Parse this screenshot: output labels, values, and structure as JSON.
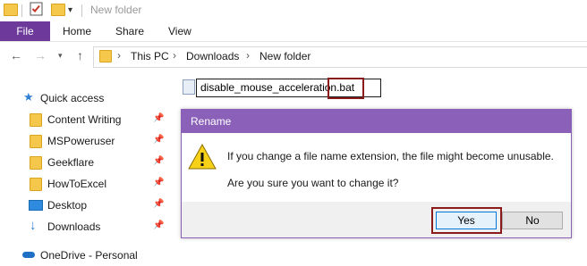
{
  "window": {
    "title": "New folder"
  },
  "ribbon": {
    "tabs": [
      "File",
      "Home",
      "Share",
      "View"
    ]
  },
  "address": {
    "crumbs": [
      "This PC",
      "Downloads",
      "New folder"
    ]
  },
  "sidebar": {
    "items": [
      {
        "label": "Quick access",
        "icon": "star-icon",
        "pinned": false
      },
      {
        "label": "Content Writing",
        "icon": "folder-icon",
        "pinned": true
      },
      {
        "label": "MSPoweruser",
        "icon": "folder-icon",
        "pinned": true
      },
      {
        "label": "Geekflare",
        "icon": "folder-icon",
        "pinned": true
      },
      {
        "label": "HowToExcel",
        "icon": "folder-icon",
        "pinned": true
      },
      {
        "label": "Desktop",
        "icon": "desktop-icon",
        "pinned": true
      },
      {
        "label": "Downloads",
        "icon": "download-icon",
        "pinned": true
      },
      {
        "label": "OneDrive - Personal",
        "icon": "cloud-icon",
        "pinned": false
      }
    ]
  },
  "file": {
    "rename_value": "disable_mouse_acceleration.bat"
  },
  "dialog": {
    "title": "Rename",
    "message1": "If you change a file name extension, the file might become unusable.",
    "message2": "Are you sure you want to change it?",
    "yes_label": "Yes",
    "no_label": "No"
  },
  "colors": {
    "accent": "#6d3a9c",
    "dialog_title": "#8a60b8",
    "highlight": "#8b1a1a"
  }
}
